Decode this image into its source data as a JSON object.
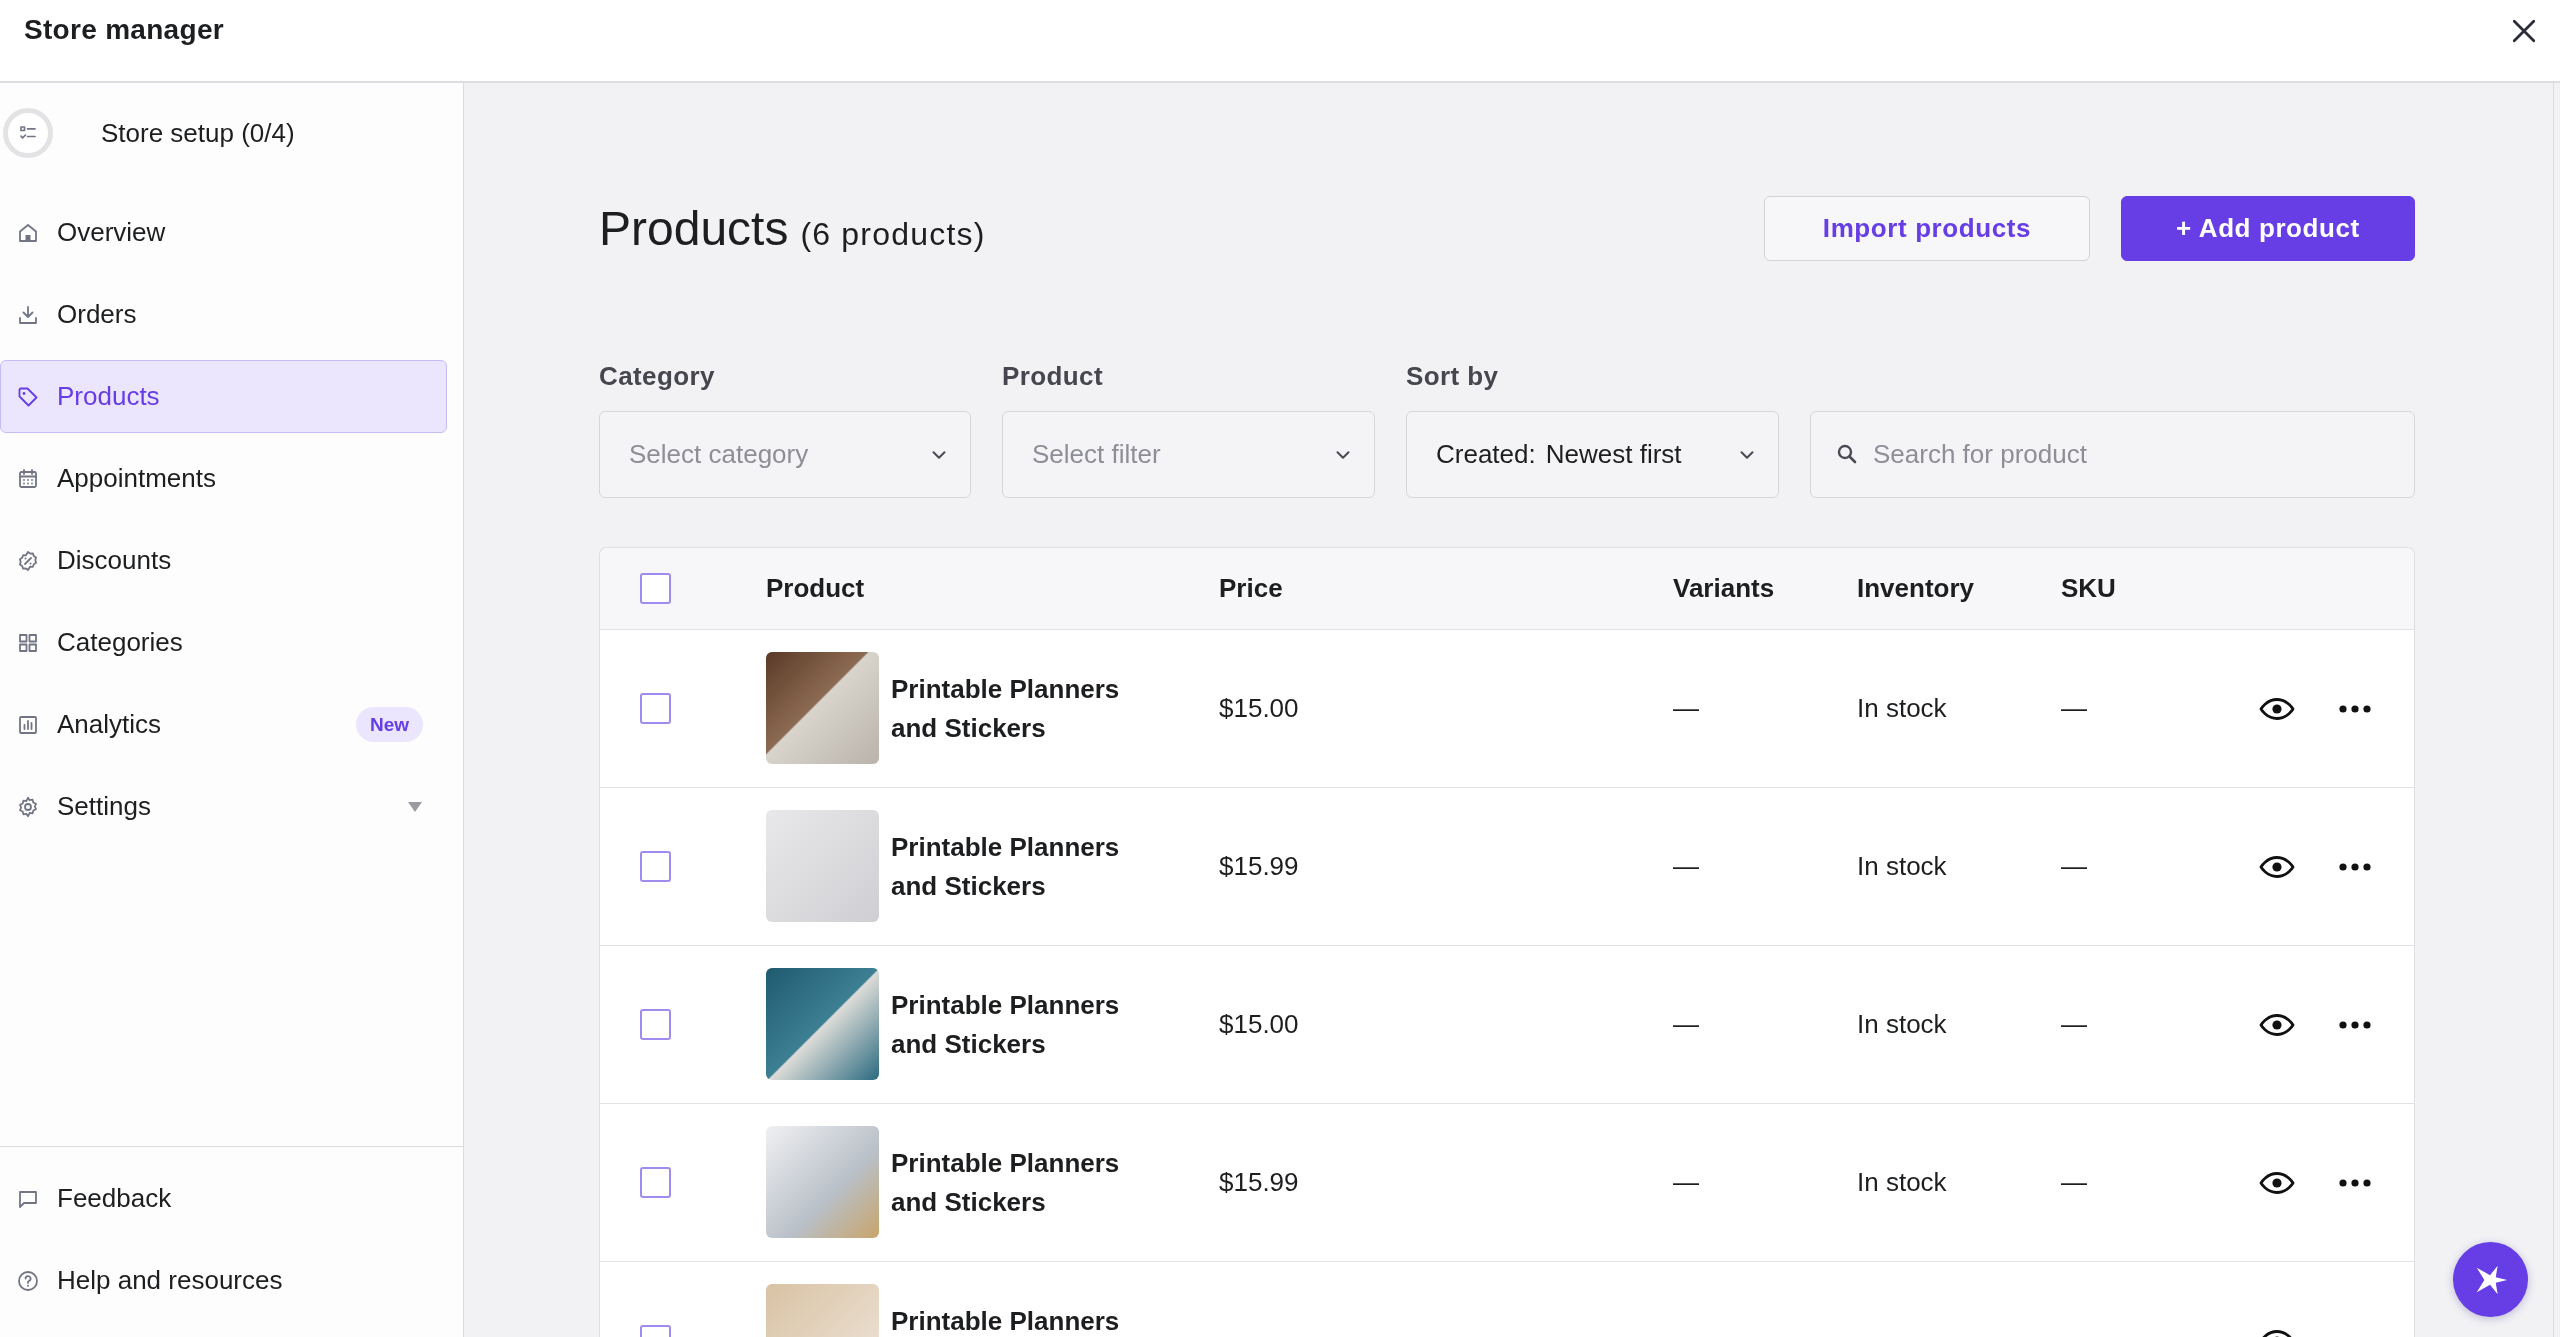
{
  "window": {
    "title": "Store manager"
  },
  "sidebar": {
    "store_setup": {
      "label": "Store setup (0/4)"
    },
    "items": [
      {
        "label": "Overview",
        "selected": false
      },
      {
        "label": "Orders",
        "selected": false
      },
      {
        "label": "Products",
        "selected": true
      },
      {
        "label": "Appointments",
        "selected": false
      },
      {
        "label": "Discounts",
        "selected": false
      },
      {
        "label": "Categories",
        "selected": false
      },
      {
        "label": "Analytics",
        "selected": false,
        "badge": "New"
      },
      {
        "label": "Settings",
        "selected": false,
        "expanded": false
      }
    ],
    "footer_items": [
      {
        "label": "Feedback"
      },
      {
        "label": "Help and resources"
      }
    ]
  },
  "page": {
    "title": "Products",
    "count": "(6 products)",
    "buttons": [
      {
        "label": "Import products",
        "kind": "secondary"
      },
      {
        "label": "+ Add product",
        "kind": "primary"
      }
    ]
  },
  "filters": [
    {
      "kind": "select",
      "label": "Category",
      "placeholder": "Select category"
    },
    {
      "kind": "select",
      "label": "Product",
      "placeholder": "Select filter"
    },
    {
      "kind": "select",
      "label": "Sort by",
      "prefix": "Created:",
      "value": "Newest first"
    },
    {
      "kind": "search",
      "placeholder": "Search for product"
    }
  ],
  "table": {
    "select_all": {
      "checked": false
    },
    "columns": [
      "Product",
      "Price",
      "Variants",
      "Inventory",
      "SKU"
    ],
    "rows": [
      {
        "checked": false,
        "name": "Printable Planners and Stickers",
        "price": "$15.00",
        "variants": "—",
        "inventory": "In stock",
        "sku": "—"
      },
      {
        "checked": false,
        "name": "Printable Planners and Stickers",
        "price": "$15.99",
        "variants": "—",
        "inventory": "In stock",
        "sku": "—"
      },
      {
        "checked": false,
        "name": "Printable Planners and Stickers",
        "price": "$15.00",
        "variants": "—",
        "inventory": "In stock",
        "sku": "—"
      },
      {
        "checked": false,
        "name": "Printable Planners and Stickers",
        "price": "$15.99",
        "variants": "—",
        "inventory": "In stock",
        "sku": "—"
      },
      {
        "checked": false,
        "name": "Printable Planners"
      }
    ]
  }
}
